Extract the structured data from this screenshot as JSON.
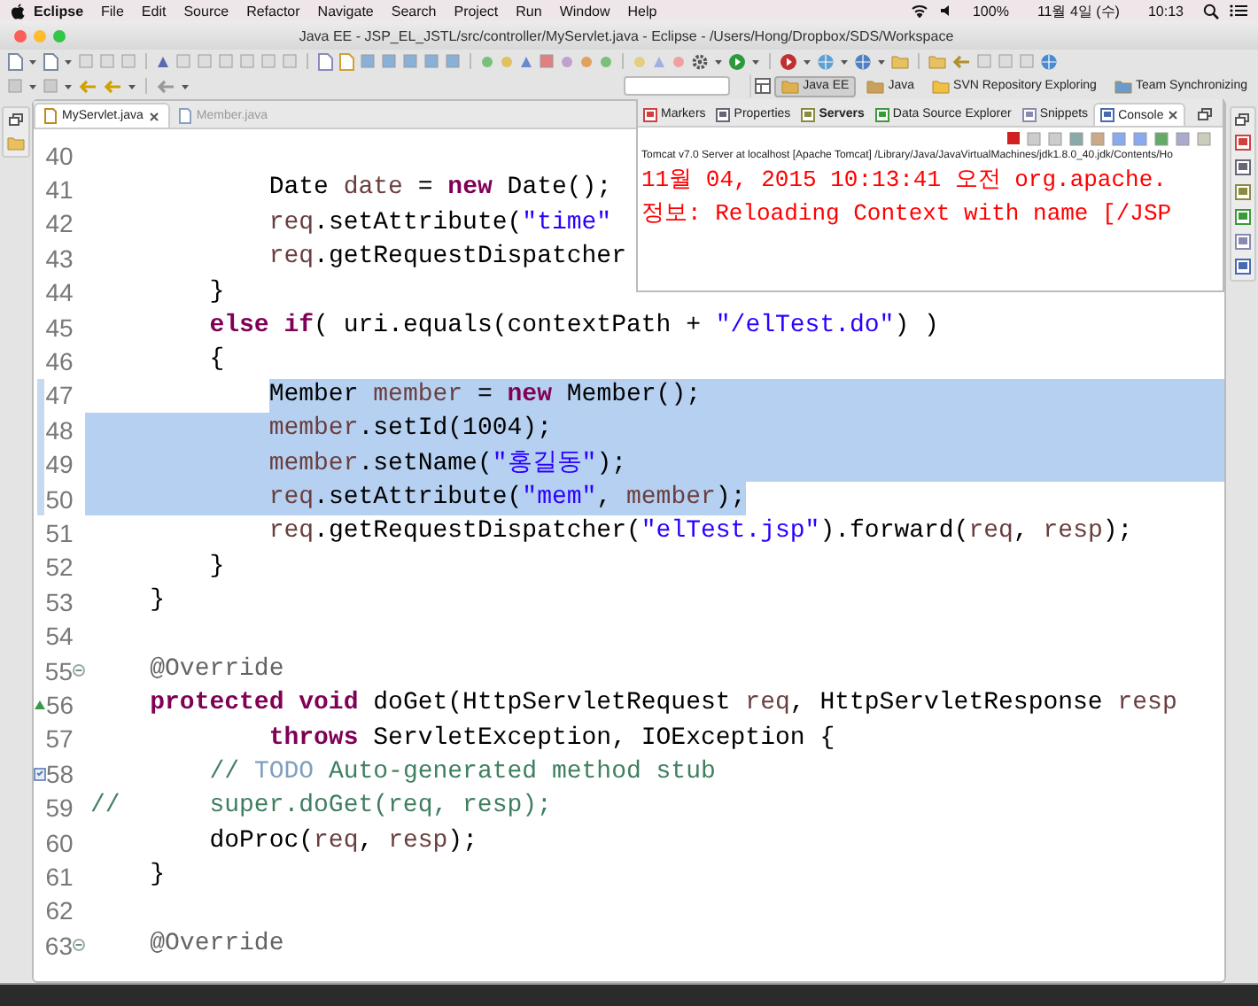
{
  "menubar": {
    "app": "Eclipse",
    "menus": [
      "File",
      "Edit",
      "Source",
      "Refactor",
      "Navigate",
      "Search",
      "Project",
      "Run",
      "Window",
      "Help"
    ],
    "battery": "100%",
    "date": "11월 4일 (수)",
    "time": "10:13"
  },
  "window": {
    "title": "Java EE - JSP_EL_JSTL/src/controller/MyServlet.java - Eclipse - /Users/Hong/Dropbox/SDS/Workspace"
  },
  "perspectives": [
    {
      "label": "Java EE",
      "selected": true
    },
    {
      "label": "Java",
      "selected": false
    },
    {
      "label": "SVN Repository Exploring",
      "selected": false
    },
    {
      "label": "Team Synchronizing",
      "selected": false
    }
  ],
  "editor": {
    "tabs": [
      {
        "label": "MyServlet.java",
        "selected": true
      },
      {
        "label": "Member.java",
        "selected": false
      }
    ],
    "lines": [
      {
        "number": "40",
        "selected": false,
        "selected_indent": false,
        "selected_to_end": false,
        "foldable": false,
        "overrides": false,
        "has_task": false
      },
      {
        "number": "41",
        "selected": false,
        "selected_indent": false,
        "selected_to_end": false,
        "foldable": false,
        "overrides": false,
        "has_task": false,
        "tokens": [
          {
            "kind": "plain",
            "text": "            Date "
          },
          {
            "kind": "variable",
            "text": "date"
          },
          {
            "kind": "plain",
            "text": " = "
          },
          {
            "kind": "keyword",
            "text": "new"
          },
          {
            "kind": "plain",
            "text": " Date();"
          }
        ]
      },
      {
        "number": "42",
        "selected": false,
        "selected_indent": false,
        "selected_to_end": false,
        "foldable": false,
        "overrides": false,
        "has_task": false,
        "tokens": [
          {
            "kind": "variable",
            "text": "            req"
          },
          {
            "kind": "plain",
            "text": ".setAttribute("
          },
          {
            "kind": "string",
            "text": "\"time\""
          }
        ]
      },
      {
        "number": "43",
        "selected": false,
        "selected_indent": false,
        "selected_to_end": false,
        "foldable": false,
        "overrides": false,
        "has_task": false,
        "tokens": [
          {
            "kind": "variable",
            "text": "            req"
          },
          {
            "kind": "plain",
            "text": ".getRequestDispatcher"
          }
        ]
      },
      {
        "number": "44",
        "selected": false,
        "selected_indent": false,
        "selected_to_end": false,
        "foldable": false,
        "overrides": false,
        "has_task": false,
        "tokens": [
          {
            "kind": "plain",
            "text": "        }"
          }
        ]
      },
      {
        "number": "45",
        "selected": false,
        "selected_indent": false,
        "selected_to_end": false,
        "foldable": false,
        "overrides": false,
        "has_task": false,
        "tokens": [
          {
            "kind": "keyword",
            "text": "        else "
          },
          {
            "kind": "keyword",
            "text": "if"
          },
          {
            "kind": "plain",
            "text": "( uri.equals(contextPath + "
          },
          {
            "kind": "string",
            "text": "\"/elTest.do\""
          },
          {
            "kind": "plain",
            "text": ") )"
          }
        ]
      },
      {
        "number": "46",
        "selected": false,
        "selected_indent": false,
        "selected_to_end": false,
        "foldable": false,
        "overrides": false,
        "has_task": false,
        "tokens": [
          {
            "kind": "plain",
            "text": "        {"
          }
        ]
      },
      {
        "number": "47",
        "selected": true,
        "selected_indent": false,
        "selected_to_end": true,
        "foldable": false,
        "overrides": false,
        "has_task": false,
        "tokens": [
          {
            "kind": "plain",
            "text": "            Member "
          },
          {
            "kind": "variable",
            "text": "member"
          },
          {
            "kind": "plain",
            "text": " = "
          },
          {
            "kind": "keyword",
            "text": "new"
          },
          {
            "kind": "plain",
            "text": " Member();"
          }
        ]
      },
      {
        "number": "48",
        "selected": true,
        "selected_indent": true,
        "selected_to_end": true,
        "foldable": false,
        "overrides": false,
        "has_task": false,
        "tokens": [
          {
            "kind": "variable",
            "text": "            member"
          },
          {
            "kind": "plain",
            "text": ".setId(1004);"
          }
        ]
      },
      {
        "number": "49",
        "selected": true,
        "selected_indent": true,
        "selected_to_end": true,
        "foldable": false,
        "overrides": false,
        "has_task": false,
        "tokens": [
          {
            "kind": "variable",
            "text": "            member"
          },
          {
            "kind": "plain",
            "text": ".setName("
          },
          {
            "kind": "string",
            "text": "\"홍길동\""
          },
          {
            "kind": "plain",
            "text": ");"
          }
        ]
      },
      {
        "number": "50",
        "selected": true,
        "selected_indent": true,
        "selected_to_end": false,
        "foldable": false,
        "overrides": false,
        "has_task": false,
        "tokens": [
          {
            "kind": "variable",
            "text": "            req"
          },
          {
            "kind": "plain",
            "text": ".setAttribute("
          },
          {
            "kind": "string",
            "text": "\"mem\""
          },
          {
            "kind": "plain",
            "text": ", "
          },
          {
            "kind": "variable",
            "text": "member"
          },
          {
            "kind": "plain",
            "text": ");"
          }
        ]
      },
      {
        "number": "51",
        "selected": false,
        "selected_indent": false,
        "selected_to_end": false,
        "foldable": false,
        "overrides": false,
        "has_task": false,
        "tokens": [
          {
            "kind": "variable",
            "text": "            req"
          },
          {
            "kind": "plain",
            "text": ".getRequestDispatcher("
          },
          {
            "kind": "string",
            "text": "\"elTest.jsp\""
          },
          {
            "kind": "plain",
            "text": ").forward("
          },
          {
            "kind": "variable",
            "text": "req"
          },
          {
            "kind": "plain",
            "text": ", "
          },
          {
            "kind": "variable",
            "text": "resp"
          },
          {
            "kind": "plain",
            "text": ");"
          }
        ]
      },
      {
        "number": "52",
        "selected": false,
        "selected_indent": false,
        "selected_to_end": false,
        "foldable": false,
        "overrides": false,
        "has_task": false,
        "tokens": [
          {
            "kind": "plain",
            "text": "        }"
          }
        ]
      },
      {
        "number": "53",
        "selected": false,
        "selected_indent": false,
        "selected_to_end": false,
        "foldable": false,
        "overrides": false,
        "has_task": false,
        "tokens": [
          {
            "kind": "plain",
            "text": "    }"
          }
        ]
      },
      {
        "number": "54",
        "selected": false,
        "selected_indent": false,
        "selected_to_end": false,
        "foldable": false,
        "overrides": false,
        "has_task": false
      },
      {
        "number": "55",
        "selected": false,
        "selected_indent": false,
        "selected_to_end": false,
        "foldable": true,
        "overrides": false,
        "has_task": false,
        "tokens": [
          {
            "kind": "annotation",
            "text": "    @Override"
          }
        ]
      },
      {
        "number": "56",
        "selected": false,
        "selected_indent": false,
        "selected_to_end": false,
        "foldable": false,
        "overrides": true,
        "has_task": false,
        "tokens": [
          {
            "kind": "keyword",
            "text": "    protected void"
          },
          {
            "kind": "plain",
            "text": " doGet(HttpServletRequest "
          },
          {
            "kind": "variable",
            "text": "req"
          },
          {
            "kind": "plain",
            "text": ", HttpServletResponse "
          },
          {
            "kind": "variable",
            "text": "resp"
          }
        ]
      },
      {
        "number": "57",
        "selected": false,
        "selected_indent": false,
        "selected_to_end": false,
        "foldable": false,
        "overrides": false,
        "has_task": false,
        "tokens": [
          {
            "kind": "keyword",
            "text": "            throws"
          },
          {
            "kind": "plain",
            "text": " ServletException, IOException {"
          }
        ]
      },
      {
        "number": "58",
        "selected": false,
        "selected_indent": false,
        "selected_to_end": false,
        "foldable": false,
        "overrides": false,
        "has_task": true,
        "tokens": [
          {
            "kind": "comment",
            "text": "        // "
          },
          {
            "kind": "todo",
            "text": "TODO"
          },
          {
            "kind": "comment",
            "text": " Auto-generated method stub"
          }
        ]
      },
      {
        "number": "59",
        "selected": false,
        "selected_indent": false,
        "selected_to_end": false,
        "foldable": false,
        "overrides": false,
        "has_task": false,
        "tokens": [
          {
            "kind": "comment",
            "text": "//      super.doGet(req, resp);"
          }
        ]
      },
      {
        "number": "60",
        "selected": false,
        "selected_indent": false,
        "selected_to_end": false,
        "foldable": false,
        "overrides": false,
        "has_task": false,
        "tokens": [
          {
            "kind": "plain",
            "text": "        doProc("
          },
          {
            "kind": "variable",
            "text": "req"
          },
          {
            "kind": "plain",
            "text": ", "
          },
          {
            "kind": "variable",
            "text": "resp"
          },
          {
            "kind": "plain",
            "text": ");"
          }
        ]
      },
      {
        "number": "61",
        "selected": false,
        "selected_indent": false,
        "selected_to_end": false,
        "foldable": false,
        "overrides": false,
        "has_task": false,
        "tokens": [
          {
            "kind": "plain",
            "text": "    }"
          }
        ]
      },
      {
        "number": "62",
        "selected": false,
        "selected_indent": false,
        "selected_to_end": false,
        "foldable": false,
        "overrides": false,
        "has_task": false
      },
      {
        "number": "63",
        "selected": false,
        "selected_indent": false,
        "selected_to_end": false,
        "foldable": true,
        "overrides": false,
        "has_task": false,
        "tokens": [
          {
            "kind": "annotation",
            "text": "    @Override"
          }
        ]
      }
    ]
  },
  "console_view": {
    "tabs": [
      {
        "label": "Markers",
        "selected": false
      },
      {
        "label": "Properties",
        "selected": false
      },
      {
        "label": "Servers",
        "selected": false
      },
      {
        "label": "Data Source Explorer",
        "selected": false
      },
      {
        "label": "Snippets",
        "selected": false
      },
      {
        "label": "Console",
        "selected": true
      }
    ],
    "description": "Tomcat v7.0 Server at localhost [Apache Tomcat] /Library/Java/JavaVirtualMachines/jdk1.8.0_40.jdk/Contents/Ho",
    "output": [
      "11월 04, 2015 10:13:41 오전 org.apache.",
      "정보: Reloading Context with name [/JSP"
    ]
  }
}
